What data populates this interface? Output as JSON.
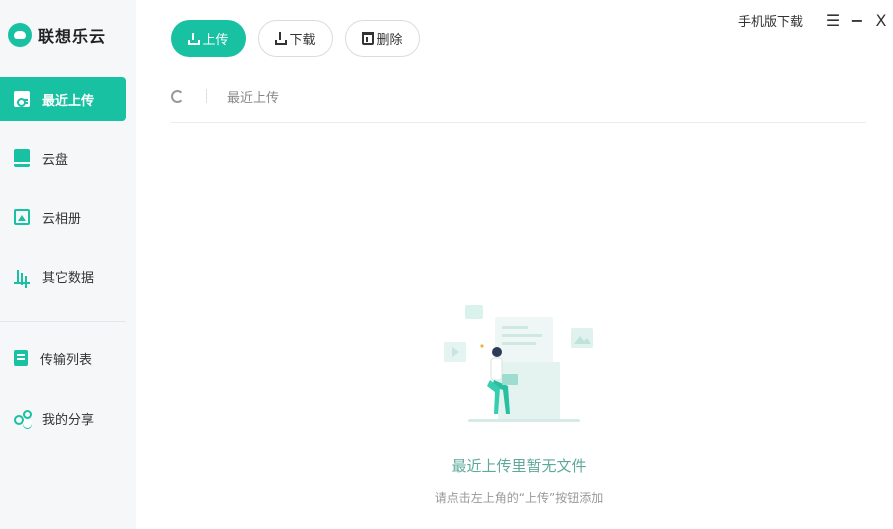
{
  "app": {
    "name": "联想乐云"
  },
  "sidebar": {
    "items": [
      {
        "label": "最近上传",
        "icon": "recent-upload-icon",
        "active": true
      },
      {
        "label": "云盘",
        "icon": "cloud-disk-icon",
        "active": false
      },
      {
        "label": "云相册",
        "icon": "photo-album-icon",
        "active": false
      },
      {
        "label": "其它数据",
        "icon": "bar-chart-icon",
        "active": false
      },
      {
        "label": "传输列表",
        "icon": "transfer-list-icon",
        "active": false
      },
      {
        "label": "我的分享",
        "icon": "share-icon",
        "active": false
      }
    ]
  },
  "toolbar": {
    "upload_label": "上传",
    "download_label": "下载",
    "delete_label": "删除"
  },
  "window": {
    "mobile_download": "手机版下载",
    "menu_glyph": "☰",
    "minimize_glyph": "−",
    "close_glyph": "X"
  },
  "breadcrumb": {
    "current": "最近上传"
  },
  "empty_state": {
    "title": "最近上传里暂无文件",
    "subtitle": "请点击左上角的“上传”按钮添加"
  },
  "colors": {
    "accent": "#17c1a2",
    "sidebar_bg": "#f5f7f9"
  }
}
